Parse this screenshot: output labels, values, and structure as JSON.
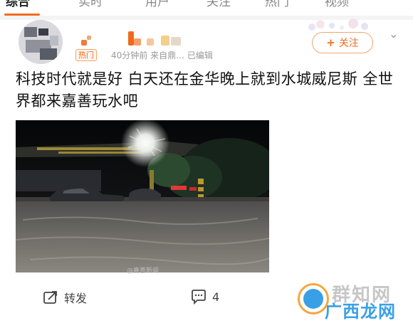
{
  "tabs": [
    {
      "label": "综合"
    },
    {
      "label": "实时"
    },
    {
      "label": "用户"
    },
    {
      "label": "关注"
    },
    {
      "label": "热门"
    },
    {
      "label": "视频"
    }
  ],
  "accent": "#f36b1c",
  "post": {
    "badge": "热门",
    "meta": "40分钟前  来自鼎…  已编辑",
    "follow_label": "关注",
    "text": "科技时代就是好 白天还在金华晚上就到水城威尼斯 全世界都来嘉善玩水吧",
    "watermark": "@嘉善新闻"
  },
  "actions": {
    "repost_label": "转发",
    "comment_count": "4"
  },
  "site_logo": {
    "text_top": "群知网",
    "text_bottom": "广西龙网"
  }
}
